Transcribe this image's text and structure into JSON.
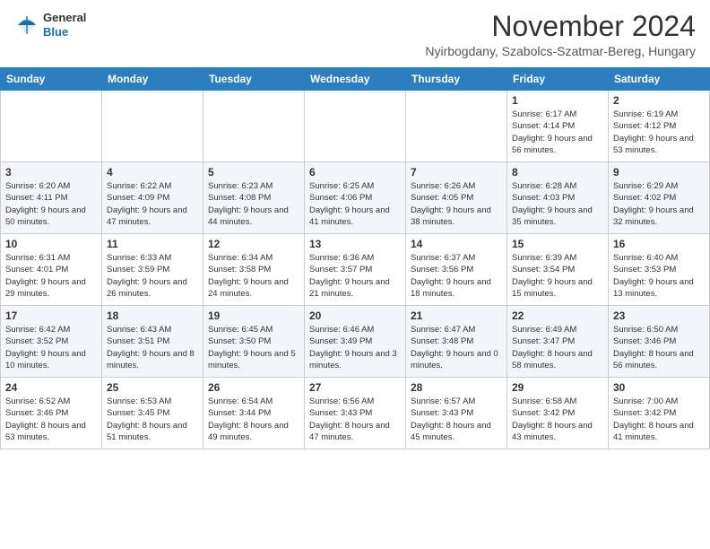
{
  "header": {
    "logo": {
      "general": "General",
      "blue": "Blue"
    },
    "title": "November 2024",
    "location": "Nyirbogdany, Szabolcs-Szatmar-Bereg, Hungary"
  },
  "calendar": {
    "days_of_week": [
      "Sunday",
      "Monday",
      "Tuesday",
      "Wednesday",
      "Thursday",
      "Friday",
      "Saturday"
    ],
    "weeks": [
      [
        {
          "day": "",
          "info": ""
        },
        {
          "day": "",
          "info": ""
        },
        {
          "day": "",
          "info": ""
        },
        {
          "day": "",
          "info": ""
        },
        {
          "day": "",
          "info": ""
        },
        {
          "day": "1",
          "info": "Sunrise: 6:17 AM\nSunset: 4:14 PM\nDaylight: 9 hours and 56 minutes."
        },
        {
          "day": "2",
          "info": "Sunrise: 6:19 AM\nSunset: 4:12 PM\nDaylight: 9 hours and 53 minutes."
        }
      ],
      [
        {
          "day": "3",
          "info": "Sunrise: 6:20 AM\nSunset: 4:11 PM\nDaylight: 9 hours and 50 minutes."
        },
        {
          "day": "4",
          "info": "Sunrise: 6:22 AM\nSunset: 4:09 PM\nDaylight: 9 hours and 47 minutes."
        },
        {
          "day": "5",
          "info": "Sunrise: 6:23 AM\nSunset: 4:08 PM\nDaylight: 9 hours and 44 minutes."
        },
        {
          "day": "6",
          "info": "Sunrise: 6:25 AM\nSunset: 4:06 PM\nDaylight: 9 hours and 41 minutes."
        },
        {
          "day": "7",
          "info": "Sunrise: 6:26 AM\nSunset: 4:05 PM\nDaylight: 9 hours and 38 minutes."
        },
        {
          "day": "8",
          "info": "Sunrise: 6:28 AM\nSunset: 4:03 PM\nDaylight: 9 hours and 35 minutes."
        },
        {
          "day": "9",
          "info": "Sunrise: 6:29 AM\nSunset: 4:02 PM\nDaylight: 9 hours and 32 minutes."
        }
      ],
      [
        {
          "day": "10",
          "info": "Sunrise: 6:31 AM\nSunset: 4:01 PM\nDaylight: 9 hours and 29 minutes."
        },
        {
          "day": "11",
          "info": "Sunrise: 6:33 AM\nSunset: 3:59 PM\nDaylight: 9 hours and 26 minutes."
        },
        {
          "day": "12",
          "info": "Sunrise: 6:34 AM\nSunset: 3:58 PM\nDaylight: 9 hours and 24 minutes."
        },
        {
          "day": "13",
          "info": "Sunrise: 6:36 AM\nSunset: 3:57 PM\nDaylight: 9 hours and 21 minutes."
        },
        {
          "day": "14",
          "info": "Sunrise: 6:37 AM\nSunset: 3:56 PM\nDaylight: 9 hours and 18 minutes."
        },
        {
          "day": "15",
          "info": "Sunrise: 6:39 AM\nSunset: 3:54 PM\nDaylight: 9 hours and 15 minutes."
        },
        {
          "day": "16",
          "info": "Sunrise: 6:40 AM\nSunset: 3:53 PM\nDaylight: 9 hours and 13 minutes."
        }
      ],
      [
        {
          "day": "17",
          "info": "Sunrise: 6:42 AM\nSunset: 3:52 PM\nDaylight: 9 hours and 10 minutes."
        },
        {
          "day": "18",
          "info": "Sunrise: 6:43 AM\nSunset: 3:51 PM\nDaylight: 9 hours and 8 minutes."
        },
        {
          "day": "19",
          "info": "Sunrise: 6:45 AM\nSunset: 3:50 PM\nDaylight: 9 hours and 5 minutes."
        },
        {
          "day": "20",
          "info": "Sunrise: 6:46 AM\nSunset: 3:49 PM\nDaylight: 9 hours and 3 minutes."
        },
        {
          "day": "21",
          "info": "Sunrise: 6:47 AM\nSunset: 3:48 PM\nDaylight: 9 hours and 0 minutes."
        },
        {
          "day": "22",
          "info": "Sunrise: 6:49 AM\nSunset: 3:47 PM\nDaylight: 8 hours and 58 minutes."
        },
        {
          "day": "23",
          "info": "Sunrise: 6:50 AM\nSunset: 3:46 PM\nDaylight: 8 hours and 56 minutes."
        }
      ],
      [
        {
          "day": "24",
          "info": "Sunrise: 6:52 AM\nSunset: 3:46 PM\nDaylight: 8 hours and 53 minutes."
        },
        {
          "day": "25",
          "info": "Sunrise: 6:53 AM\nSunset: 3:45 PM\nDaylight: 8 hours and 51 minutes."
        },
        {
          "day": "26",
          "info": "Sunrise: 6:54 AM\nSunset: 3:44 PM\nDaylight: 8 hours and 49 minutes."
        },
        {
          "day": "27",
          "info": "Sunrise: 6:56 AM\nSunset: 3:43 PM\nDaylight: 8 hours and 47 minutes."
        },
        {
          "day": "28",
          "info": "Sunrise: 6:57 AM\nSunset: 3:43 PM\nDaylight: 8 hours and 45 minutes."
        },
        {
          "day": "29",
          "info": "Sunrise: 6:58 AM\nSunset: 3:42 PM\nDaylight: 8 hours and 43 minutes."
        },
        {
          "day": "30",
          "info": "Sunrise: 7:00 AM\nSunset: 3:42 PM\nDaylight: 8 hours and 41 minutes."
        }
      ]
    ]
  }
}
